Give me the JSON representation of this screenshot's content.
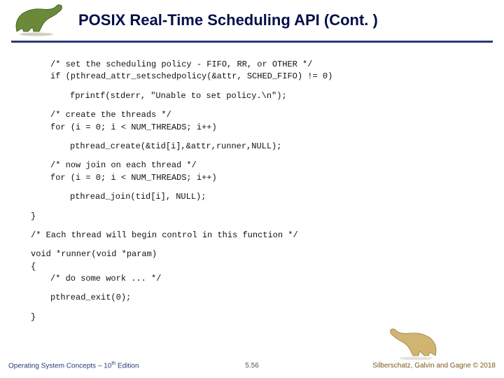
{
  "header": {
    "title": "POSIX Real-Time Scheduling API (Cont. )"
  },
  "code": {
    "c1a": "/* set the scheduling policy - FIFO, RR, or OTHER */",
    "c1b": "if (pthread_attr_setschedpolicy(&attr, SCHED_FIFO) != 0)",
    "c2": "fprintf(stderr, \"Unable to set policy.\\n\");",
    "c3a": "/* create the threads */",
    "c3b": "for (i = 0; i < NUM_THREADS; i++)",
    "c4": "pthread_create(&tid[i],&attr,runner,NULL);",
    "c5a": "/* now join on each thread */",
    "c5b": "for (i = 0; i < NUM_THREADS; i++)",
    "c6": "pthread_join(tid[i], NULL);",
    "c7": "}",
    "c8": "/* Each thread will begin control in this function */",
    "c9": "void *runner(void *param)",
    "c10": "{",
    "c11": "/* do some work ... */",
    "c12": "pthread_exit(0);",
    "c13": "}"
  },
  "footer": {
    "left_a": "Operating System Concepts – 10",
    "left_b": " Edition",
    "center": "5.56",
    "right": "Silberschatz, Galvin and Gagne © 2018"
  },
  "icons": {
    "dino_left": "dinosaur-icon",
    "dino_right": "dinosaur-icon"
  }
}
